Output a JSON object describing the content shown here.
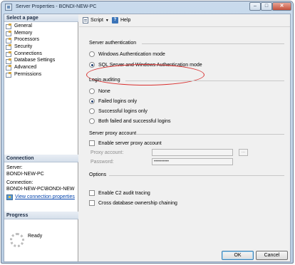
{
  "window": {
    "title": "Server Properties - BONDI-NEW-PC"
  },
  "caption_buttons": {
    "minimize": "–",
    "maximize": "□",
    "close": "✕"
  },
  "left_pane": {
    "select_page_header": "Select a page",
    "pages": [
      "General",
      "Memory",
      "Processors",
      "Security",
      "Connections",
      "Database Settings",
      "Advanced",
      "Permissions"
    ],
    "connection_header": "Connection",
    "server_label": "Server:",
    "server_value": "BONDI-NEW-PC",
    "connection_label": "Connection:",
    "connection_value": "BONDI-NEW-PC\\BONDI-NEW",
    "view_connection_link": "View connection properties",
    "progress_header": "Progress",
    "progress_status": "Ready"
  },
  "toolbar": {
    "script_label": "Script",
    "help_label": "Help"
  },
  "server_authentication": {
    "title": "Server authentication",
    "options": [
      "Windows Authentication mode",
      "SQL Server and Windows Authentication mode"
    ],
    "selected_index": 1
  },
  "login_auditing": {
    "title": "Login auditing",
    "options": [
      "None",
      "Failed logins only",
      "Successful logins only",
      "Both failed and successful logins"
    ],
    "selected_index": 1
  },
  "server_proxy": {
    "title": "Server proxy account",
    "enable_label": "Enable server proxy account",
    "enable_checked": false,
    "proxy_account_label": "Proxy account:",
    "proxy_account_value": "",
    "password_label": "Password:",
    "password_value": "••••••••••",
    "browse_label": "..."
  },
  "options": {
    "title": "Options",
    "c2_audit_label": "Enable C2 audit tracing",
    "c2_audit_checked": false,
    "cross_db_label": "Cross database ownership chaining",
    "cross_db_checked": false
  },
  "footer": {
    "ok_label": "OK",
    "cancel_label": "Cancel"
  },
  "colors": {
    "annotation_ellipse": "#d9302f",
    "link": "#0645ad",
    "title_bar": "#c9daec"
  }
}
